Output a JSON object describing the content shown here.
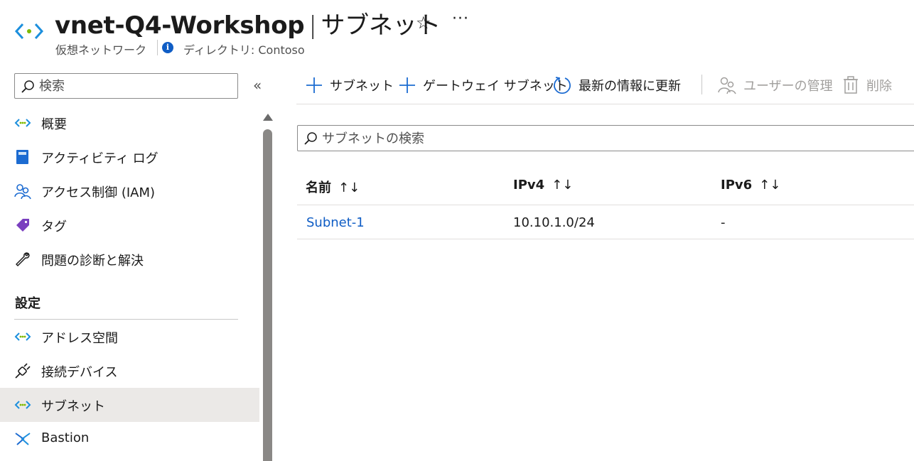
{
  "header": {
    "resource_name": "vnet-Q4-Workshop",
    "separator": "|",
    "blade_title": "サブネット",
    "resource_type": "仮想ネットワーク",
    "directory": "ディレクトリ: Contoso",
    "favorite_glyph": "☆",
    "more_glyph": "···"
  },
  "sidebar": {
    "search_placeholder": "検索",
    "collapse_glyph": "«",
    "items": [
      {
        "label": "概要",
        "icon": "vnet-icon"
      },
      {
        "label": "アクティビティ ログ",
        "icon": "activity-log-icon"
      },
      {
        "label": "アクセス制御 (IAM)",
        "icon": "iam-icon"
      },
      {
        "label": "タグ",
        "icon": "tag-icon"
      },
      {
        "label": "問題の診断と解決",
        "icon": "wrench-icon"
      }
    ],
    "settings_section": {
      "title": "設定",
      "items": [
        {
          "label": "アドレス空間",
          "icon": "vnet-icon"
        },
        {
          "label": "接続デバイス",
          "icon": "plug-icon"
        },
        {
          "label": "サブネット",
          "icon": "vnet-icon",
          "active": true
        },
        {
          "label": "Bastion",
          "icon": "bastion-icon"
        }
      ]
    }
  },
  "toolbar": {
    "add_subnet": "サブネット",
    "add_gateway_subnet": "ゲートウェイ サブネット",
    "refresh": "最新の情報に更新",
    "manage_users": "ユーザーの管理",
    "delete": "削除"
  },
  "main": {
    "search_placeholder": "サブネットの検索",
    "table": {
      "columns": [
        "名前",
        "IPv4",
        "IPv6"
      ],
      "sort_glyph": "↑↓",
      "rows": [
        {
          "name": "Subnet-1",
          "ipv4": "10.10.1.0/24",
          "ipv6": "-"
        }
      ]
    }
  },
  "colors": {
    "accent": "#0f5dc5",
    "active_row": "#ebe9e7",
    "disabled_text": "#a19f9d"
  }
}
